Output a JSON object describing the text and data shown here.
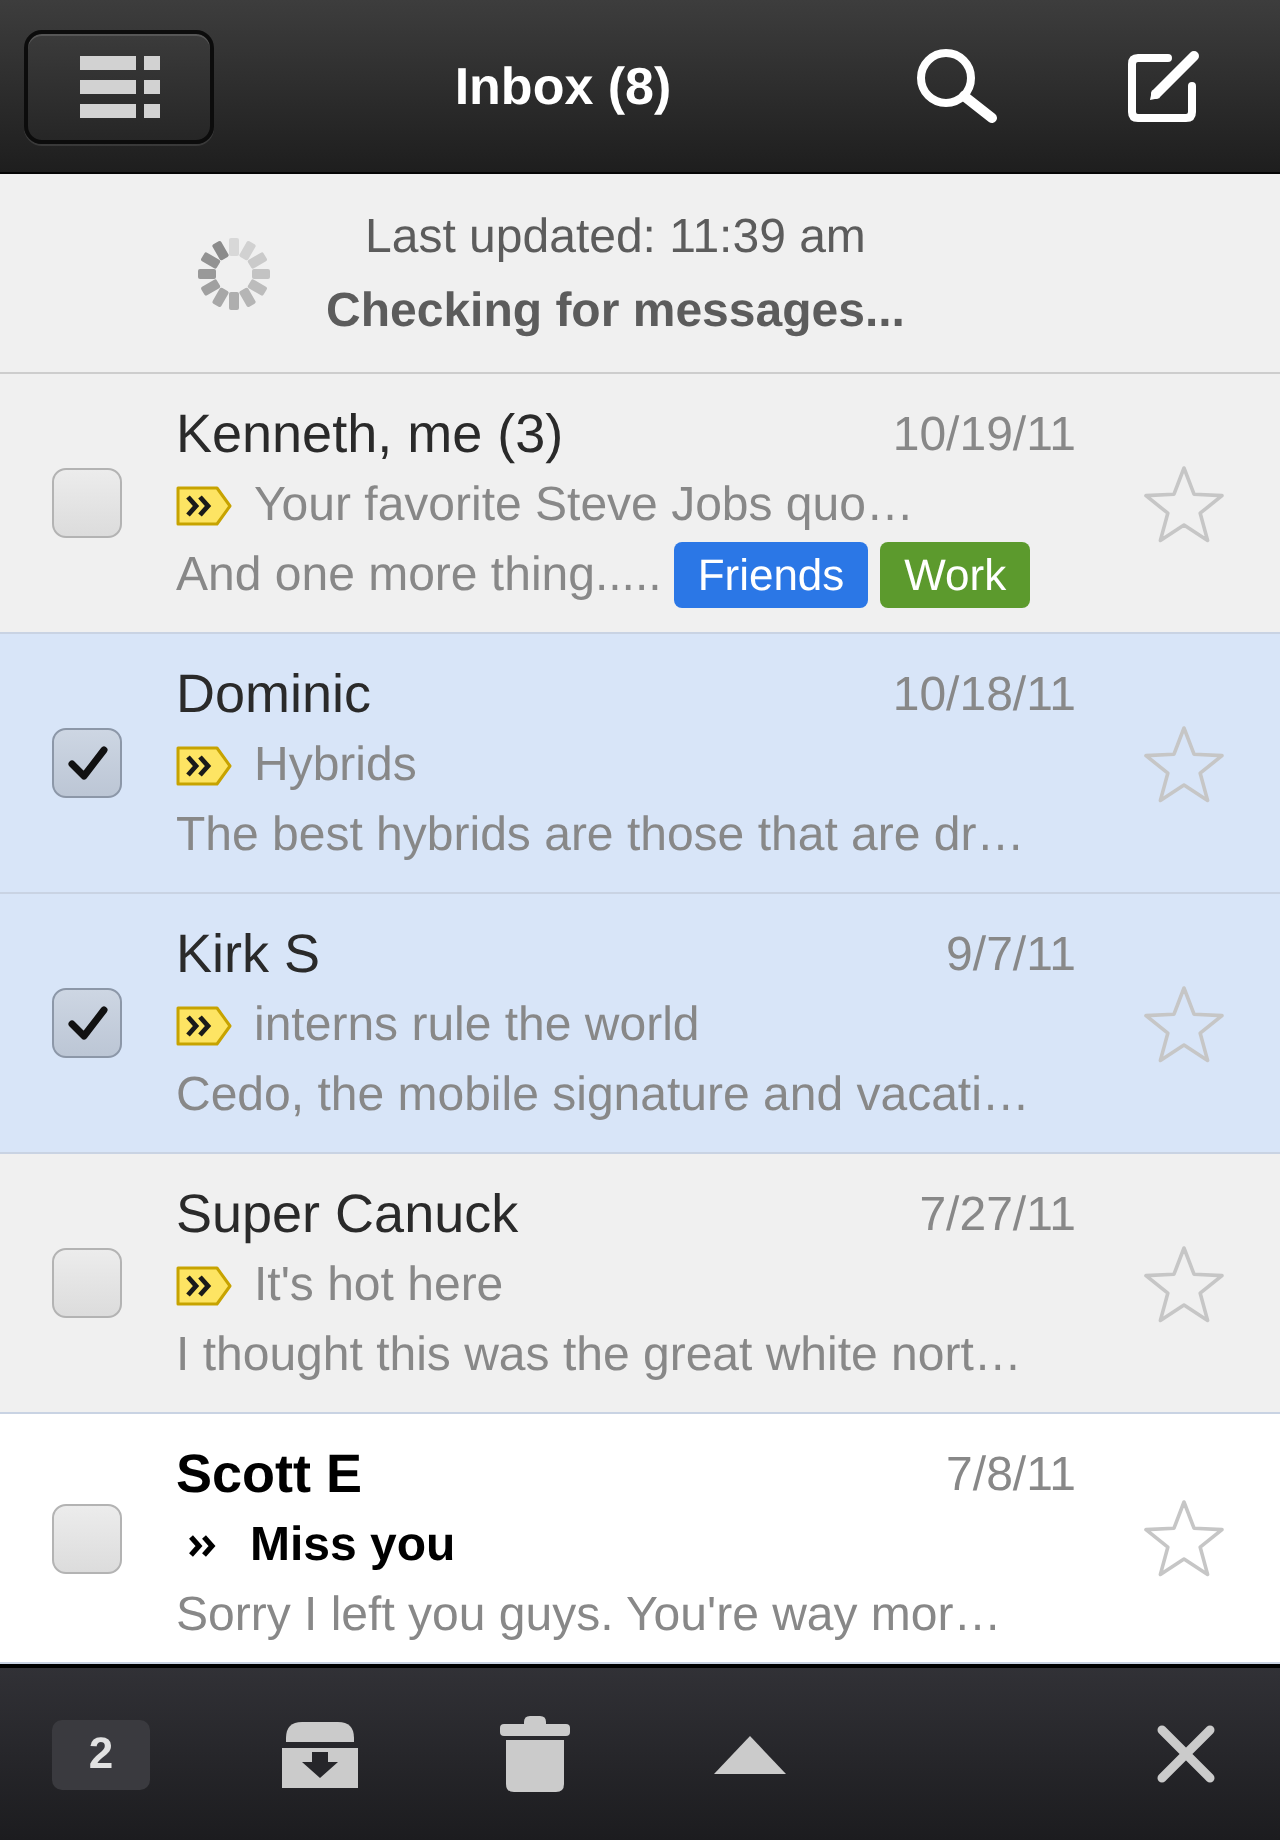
{
  "header": {
    "title": "Inbox (8)"
  },
  "status": {
    "last_updated": "Last updated: 11:39 am",
    "message": "Checking for messages..."
  },
  "messages": [
    {
      "sender": "Kenneth, me (3)",
      "date": "10/19/11",
      "important": true,
      "subject": "Your favorite Steve Jobs quo…",
      "snippet": "And one more thing.....",
      "labels": [
        {
          "text": "Friends",
          "color": "#2b77e6"
        },
        {
          "text": "Work",
          "color": "#5c9a2d"
        }
      ],
      "selected": false,
      "unread": false,
      "starred": false
    },
    {
      "sender": "Dominic",
      "date": "10/18/11",
      "important": true,
      "subject": "Hybrids",
      "snippet": "The best hybrids are those that are dr…",
      "selected": true,
      "unread": false,
      "starred": false
    },
    {
      "sender": "Kirk S",
      "date": "9/7/11",
      "important": true,
      "subject": "interns rule the world",
      "snippet": "Cedo, the mobile signature and vacati…",
      "selected": true,
      "unread": false,
      "starred": false
    },
    {
      "sender": "Super Canuck",
      "date": "7/27/11",
      "important": true,
      "subject": "It's hot here",
      "snippet": "I thought this was the great white nort…",
      "selected": false,
      "unread": false,
      "starred": false
    },
    {
      "sender": "Scott E",
      "date": "7/8/11",
      "important": false,
      "subject": "Miss you",
      "snippet": "Sorry I left you guys. You're way mor…",
      "selected": false,
      "unread": true,
      "starred": false
    }
  ],
  "toolbar": {
    "selected_count": "2"
  }
}
